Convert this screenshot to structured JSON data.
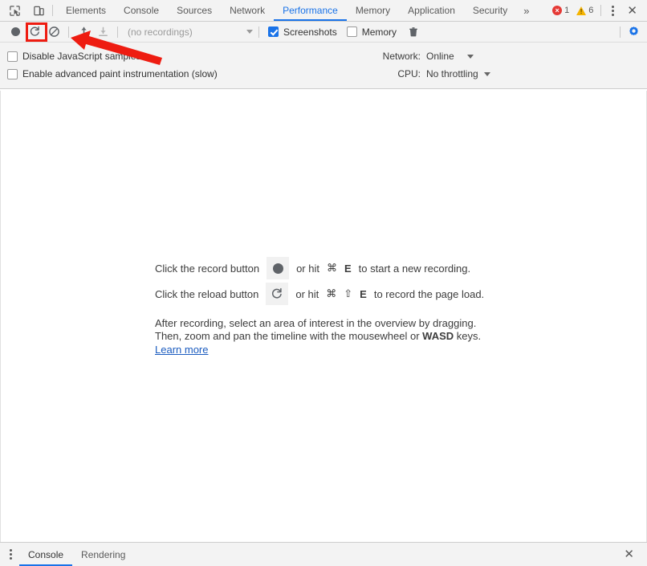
{
  "tabbar": {
    "icons": [
      {
        "name": "inspect-element-icon"
      },
      {
        "name": "device-toolbar-icon"
      }
    ],
    "tabs": [
      {
        "label": "Elements",
        "active": false
      },
      {
        "label": "Console",
        "active": false
      },
      {
        "label": "Sources",
        "active": false
      },
      {
        "label": "Network",
        "active": false
      },
      {
        "label": "Performance",
        "active": true
      },
      {
        "label": "Memory",
        "active": false
      },
      {
        "label": "Application",
        "active": false
      },
      {
        "label": "Security",
        "active": false
      }
    ],
    "more_label": "»",
    "error_count": "1",
    "warning_count": "6",
    "error_glyph": "×",
    "close_label": "✕"
  },
  "toolbar": {
    "record_title": "Record",
    "reload_title": "Start profiling and reload page",
    "clear_title": "Clear",
    "load_title": "Load profile",
    "save_title": "Save profile",
    "recordings_value": "(no recordings)",
    "screenshots_label": "Screenshots",
    "screenshots_checked": true,
    "memory_label": "Memory",
    "memory_checked": false,
    "trash_title": "Collect garbage",
    "settings_title": "Capture settings"
  },
  "settings": {
    "disable_js_label": "Disable JavaScript samples",
    "disable_js_checked": false,
    "paint_label": "Enable advanced paint instrumentation (slow)",
    "paint_checked": false,
    "network_label": "Network:",
    "network_value": "Online",
    "cpu_label": "CPU:",
    "cpu_value": "No throttling"
  },
  "landing": {
    "record_prefix": "Click the record button",
    "record_suffix_pre": "or hit",
    "record_key_mod": "⌘",
    "record_key": "E",
    "record_suffix_post": "to start a new recording.",
    "reload_prefix": "Click the reload button",
    "reload_suffix_pre": "or hit",
    "reload_key_mod": "⌘",
    "reload_key_shift": "⇧",
    "reload_key": "E",
    "reload_suffix_post": "to record the page load.",
    "para_line1": "After recording, select an area of interest in the overview by dragging.",
    "para_line2_pre": "Then, zoom and pan the timeline with the mousewheel or",
    "para_line2_bold": "WASD",
    "para_line2_post": "keys.",
    "learn_more": "Learn more"
  },
  "drawer": {
    "tabs": [
      {
        "label": "Console",
        "active": true
      },
      {
        "label": "Rendering",
        "active": false
      }
    ],
    "close_label": "✕"
  },
  "annotations": {
    "highlight_target": "reload-button",
    "arrow_color": "#ee1c11",
    "box_color": "#ee1c11"
  }
}
